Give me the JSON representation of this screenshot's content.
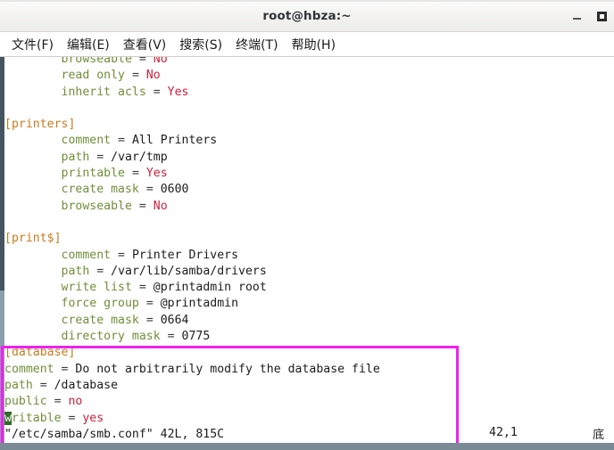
{
  "window": {
    "title": "root@hbza:~",
    "controls": [
      {
        "name": "minimize",
        "glyph": "–"
      },
      {
        "name": "maximize",
        "glyph": "◻"
      }
    ]
  },
  "menubar": {
    "items": [
      {
        "label": "文件(F)"
      },
      {
        "label": "编辑(E)"
      },
      {
        "label": "查看(V)"
      },
      {
        "label": "搜索(S)"
      },
      {
        "label": "终端(T)"
      },
      {
        "label": "帮助(H)"
      }
    ]
  },
  "terminal": {
    "editor": "vim",
    "file": "/etc/samba/smb.conf",
    "lines": [
      {
        "indent": 8,
        "key": "browseable",
        "value": "No",
        "value_kind": "bool"
      },
      {
        "indent": 8,
        "key": "read only",
        "value": "No",
        "value_kind": "bool"
      },
      {
        "indent": 8,
        "key": "inherit acls",
        "value": "Yes",
        "value_kind": "bool"
      },
      {
        "blank": true
      },
      {
        "section": "printers"
      },
      {
        "indent": 8,
        "key": "comment",
        "value": "All Printers",
        "value_kind": "plain"
      },
      {
        "indent": 8,
        "key": "path",
        "value": "/var/tmp",
        "value_kind": "plain"
      },
      {
        "indent": 8,
        "key": "printable",
        "value": "Yes",
        "value_kind": "bool"
      },
      {
        "indent": 8,
        "key": "create mask",
        "value": "0600",
        "value_kind": "plain"
      },
      {
        "indent": 8,
        "key": "browseable",
        "value": "No",
        "value_kind": "bool"
      },
      {
        "blank": true
      },
      {
        "section": "print$"
      },
      {
        "indent": 8,
        "key": "comment",
        "value": "Printer Drivers",
        "value_kind": "plain"
      },
      {
        "indent": 8,
        "key": "path",
        "value": "/var/lib/samba/drivers",
        "value_kind": "plain"
      },
      {
        "indent": 8,
        "key": "write list",
        "value": "@printadmin root",
        "value_kind": "plain"
      },
      {
        "indent": 8,
        "key": "force group",
        "value": "@printadmin",
        "value_kind": "plain"
      },
      {
        "indent": 8,
        "key": "create mask",
        "value": "0664",
        "value_kind": "plain"
      },
      {
        "indent": 8,
        "key": "directory mask",
        "value": "0775",
        "value_kind": "plain"
      },
      {
        "section": "database"
      },
      {
        "indent": 0,
        "key": "comment",
        "value": "Do not arbitrarily modify the database file",
        "value_kind": "plain"
      },
      {
        "indent": 0,
        "key": "path",
        "value": "/database",
        "value_kind": "plain"
      },
      {
        "indent": 0,
        "key": "public",
        "value": "no",
        "value_kind": "bool"
      },
      {
        "indent": 0,
        "key": "writable",
        "value": "yes",
        "value_kind": "bool",
        "cursor_at_col": 0
      }
    ],
    "status_line": "\"/etc/samba/smb.conf\" 42L, 815C",
    "ruler_position": "42,1",
    "ruler_scroll": "底"
  },
  "annotation": {
    "highlight_color": "#ee22ee",
    "highlight_label": "database-section-highlight"
  },
  "colors": {
    "key": "#6f8f3a",
    "bool_value": "#d21f3c",
    "plain_value": "#1c1c1c",
    "section": "#c97b1e",
    "cursor_bg": "#2f6b22",
    "scrollbar": "#445560"
  }
}
